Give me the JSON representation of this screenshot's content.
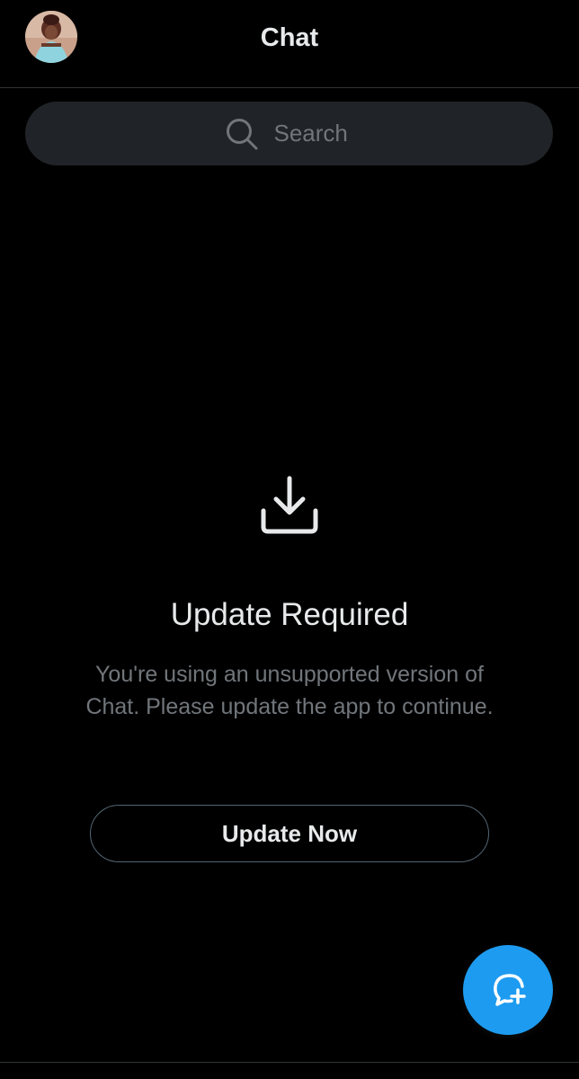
{
  "header": {
    "title": "Chat"
  },
  "search": {
    "placeholder": "Search"
  },
  "empty_state": {
    "heading": "Update Required",
    "description": "You're using an unsupported version of Chat. Please update the app to continue.",
    "button_label": "Update Now",
    "icon": "download-icon"
  },
  "icons": {
    "avatar": "avatar",
    "search": "search-icon",
    "fab": "new-message-icon"
  },
  "colors": {
    "background": "#000000",
    "primary_text": "#e7e9ea",
    "secondary_text": "#71767b",
    "search_bg": "#202327",
    "divider": "#2f3336",
    "accent": "#1d9bf0"
  }
}
